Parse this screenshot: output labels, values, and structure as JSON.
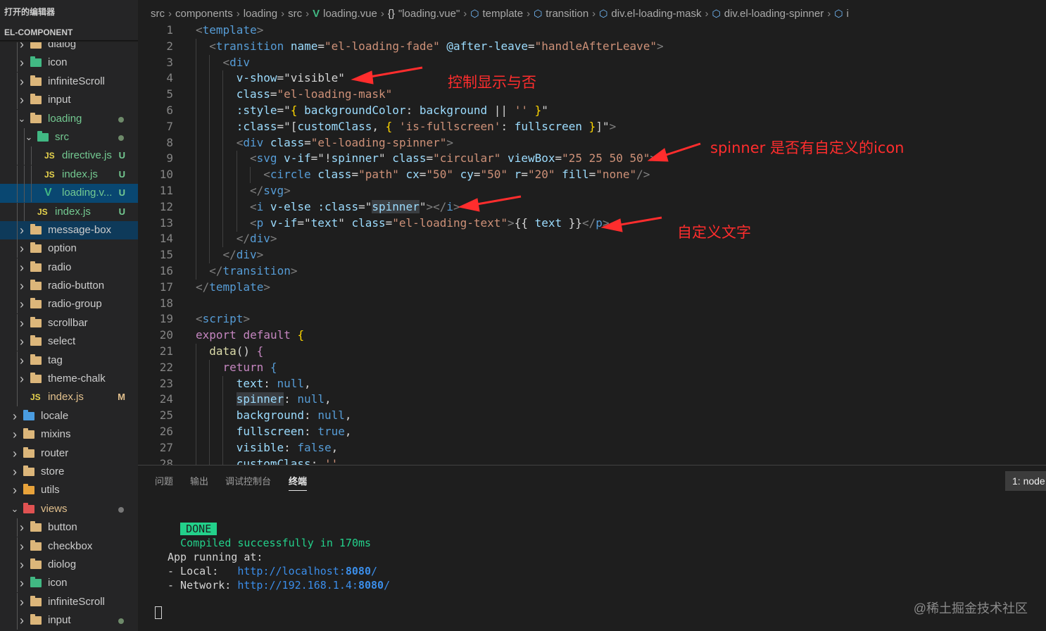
{
  "sidebar": {
    "open_editors": "打开的编辑器",
    "project": "EL-COMPONENT",
    "tree": [
      {
        "label": "dialog",
        "depth": 1,
        "kind": "folder",
        "open": false
      },
      {
        "label": "icon",
        "depth": 1,
        "kind": "folder-green",
        "open": false
      },
      {
        "label": "infiniteScroll",
        "depth": 1,
        "kind": "folder",
        "open": false
      },
      {
        "label": "input",
        "depth": 1,
        "kind": "folder",
        "open": false
      },
      {
        "label": "loading",
        "depth": 1,
        "kind": "folder",
        "open": true,
        "git": true,
        "dot": true
      },
      {
        "label": "src",
        "depth": 2,
        "kind": "folder-green",
        "open": true,
        "git": true,
        "dot": true
      },
      {
        "label": "directive.js",
        "depth": 3,
        "kind": "js",
        "git": true,
        "badge": "U"
      },
      {
        "label": "index.js",
        "depth": 3,
        "kind": "js",
        "git": true,
        "badge": "U"
      },
      {
        "label": "loading.v...",
        "depth": 3,
        "kind": "vue",
        "git": true,
        "badge": "U",
        "selected": true
      },
      {
        "label": "index.js",
        "depth": 2,
        "kind": "js",
        "git": true,
        "badge": "U"
      },
      {
        "label": "message-box",
        "depth": 1,
        "kind": "folder",
        "open": false,
        "focus": true
      },
      {
        "label": "option",
        "depth": 1,
        "kind": "folder",
        "open": false
      },
      {
        "label": "radio",
        "depth": 1,
        "kind": "folder",
        "open": false
      },
      {
        "label": "radio-button",
        "depth": 1,
        "kind": "folder",
        "open": false
      },
      {
        "label": "radio-group",
        "depth": 1,
        "kind": "folder",
        "open": false
      },
      {
        "label": "scrollbar",
        "depth": 1,
        "kind": "folder",
        "open": false
      },
      {
        "label": "select",
        "depth": 1,
        "kind": "folder",
        "open": false
      },
      {
        "label": "tag",
        "depth": 1,
        "kind": "folder",
        "open": false
      },
      {
        "label": "theme-chalk",
        "depth": 1,
        "kind": "folder",
        "open": false
      },
      {
        "label": "index.js",
        "depth": 1,
        "kind": "js",
        "gitm": true,
        "badge": "M"
      },
      {
        "label": "locale",
        "depth": 0,
        "kind": "folder-blue",
        "open": false
      },
      {
        "label": "mixins",
        "depth": 0,
        "kind": "folder",
        "open": false
      },
      {
        "label": "router",
        "depth": 0,
        "kind": "folder",
        "open": false
      },
      {
        "label": "store",
        "depth": 0,
        "kind": "folder",
        "open": false
      },
      {
        "label": "utils",
        "depth": 0,
        "kind": "folder-orange",
        "open": false
      },
      {
        "label": "views",
        "depth": 0,
        "kind": "folder-red",
        "open": true,
        "gitm": true,
        "dot": true
      },
      {
        "label": "button",
        "depth": 1,
        "kind": "folder",
        "open": false
      },
      {
        "label": "checkbox",
        "depth": 1,
        "kind": "folder",
        "open": false
      },
      {
        "label": "diolog",
        "depth": 1,
        "kind": "folder",
        "open": false
      },
      {
        "label": "icon",
        "depth": 1,
        "kind": "folder-green",
        "open": false
      },
      {
        "label": "infiniteScroll",
        "depth": 1,
        "kind": "folder",
        "open": false
      },
      {
        "label": "input",
        "depth": 1,
        "kind": "folder",
        "open": false,
        "dot": true
      }
    ]
  },
  "breadcrumb": [
    {
      "label": "src"
    },
    {
      "label": "components"
    },
    {
      "label": "loading"
    },
    {
      "label": "src"
    },
    {
      "label": "loading.vue",
      "icon": "vue-icon"
    },
    {
      "label": "\"loading.vue\"",
      "icon": "braces-icon"
    },
    {
      "label": "template",
      "icon": "cube-icon"
    },
    {
      "label": "transition",
      "icon": "cube-icon"
    },
    {
      "label": "div.el-loading-mask",
      "icon": "cube-icon"
    },
    {
      "label": "div.el-loading-spinner",
      "icon": "cube-icon"
    },
    {
      "label": "i",
      "icon": "cube-icon"
    }
  ],
  "code_lines": [
    {
      "n": "1",
      "indent": 0,
      "tokens": [
        [
          "t-tag",
          "<"
        ],
        [
          "t-name",
          "template"
        ],
        [
          "t-tag",
          ">"
        ]
      ]
    },
    {
      "n": "2",
      "indent": 1,
      "tokens": [
        [
          "t-tag",
          "<"
        ],
        [
          "t-name",
          "transition"
        ],
        [
          "t-plain",
          " "
        ],
        [
          "t-attr",
          "name"
        ],
        [
          "t-plain",
          "="
        ],
        [
          "t-str",
          "\"el-loading-fade\""
        ],
        [
          "t-plain",
          " "
        ],
        [
          "t-attr",
          "@after-leave"
        ],
        [
          "t-plain",
          "="
        ],
        [
          "t-str",
          "\"handleAfterLeave\""
        ],
        [
          "t-tag",
          ">"
        ]
      ]
    },
    {
      "n": "3",
      "indent": 2,
      "tokens": [
        [
          "t-tag",
          "<"
        ],
        [
          "t-name",
          "div"
        ]
      ]
    },
    {
      "n": "4",
      "indent": 3,
      "tokens": [
        [
          "t-attr",
          "v-show"
        ],
        [
          "t-plain",
          "="
        ],
        [
          "t-plain",
          "\"visible\""
        ]
      ]
    },
    {
      "n": "5",
      "indent": 3,
      "tokens": [
        [
          "t-attr",
          "class"
        ],
        [
          "t-plain",
          "="
        ],
        [
          "t-str",
          "\"el-loading-mask\""
        ]
      ]
    },
    {
      "n": "6",
      "indent": 3,
      "tokens": [
        [
          "t-attr",
          ":style"
        ],
        [
          "t-plain",
          "=\""
        ],
        [
          "t-brace",
          "{"
        ],
        [
          "t-plain",
          " "
        ],
        [
          "t-attr",
          "backgroundColor"
        ],
        [
          "t-plain",
          ": "
        ],
        [
          "t-attr",
          "background"
        ],
        [
          "t-plain",
          " || "
        ],
        [
          "t-str",
          "''"
        ],
        [
          "t-plain",
          " "
        ],
        [
          "t-brace",
          "}"
        ],
        [
          "t-plain",
          "\""
        ]
      ]
    },
    {
      "n": "7",
      "indent": 3,
      "tokens": [
        [
          "t-attr",
          ":class"
        ],
        [
          "t-plain",
          "=\"["
        ],
        [
          "t-attr",
          "customClass"
        ],
        [
          "t-plain",
          ", "
        ],
        [
          "t-brace",
          "{"
        ],
        [
          "t-plain",
          " "
        ],
        [
          "t-str",
          "'is-fullscreen'"
        ],
        [
          "t-plain",
          ": "
        ],
        [
          "t-attr",
          "fullscreen"
        ],
        [
          "t-plain",
          " "
        ],
        [
          "t-brace",
          "}"
        ],
        [
          "t-plain",
          "]\""
        ],
        [
          "t-tag",
          ">"
        ]
      ]
    },
    {
      "n": "8",
      "indent": 3,
      "tokens": [
        [
          "t-tag",
          "<"
        ],
        [
          "t-name",
          "div"
        ],
        [
          "t-plain",
          " "
        ],
        [
          "t-attr",
          "class"
        ],
        [
          "t-plain",
          "="
        ],
        [
          "t-str",
          "\"el-loading-spinner\""
        ],
        [
          "t-tag",
          ">"
        ]
      ]
    },
    {
      "n": "9",
      "indent": 4,
      "tokens": [
        [
          "t-tag",
          "<"
        ],
        [
          "t-name",
          "svg"
        ],
        [
          "t-plain",
          " "
        ],
        [
          "t-attr",
          "v-if"
        ],
        [
          "t-plain",
          "=\"!"
        ],
        [
          "t-attr",
          "spinner"
        ],
        [
          "t-plain",
          "\" "
        ],
        [
          "t-attr",
          "class"
        ],
        [
          "t-plain",
          "="
        ],
        [
          "t-str",
          "\"circular\""
        ],
        [
          "t-plain",
          " "
        ],
        [
          "t-attr",
          "viewBox"
        ],
        [
          "t-plain",
          "="
        ],
        [
          "t-str",
          "\"25 25 50 50\""
        ],
        [
          "t-tag",
          ">"
        ]
      ]
    },
    {
      "n": "10",
      "indent": 5,
      "tokens": [
        [
          "t-tag",
          "<"
        ],
        [
          "t-name",
          "circle"
        ],
        [
          "t-plain",
          " "
        ],
        [
          "t-attr",
          "class"
        ],
        [
          "t-plain",
          "="
        ],
        [
          "t-str",
          "\"path\""
        ],
        [
          "t-plain",
          " "
        ],
        [
          "t-attr",
          "cx"
        ],
        [
          "t-plain",
          "="
        ],
        [
          "t-str",
          "\"50\""
        ],
        [
          "t-plain",
          " "
        ],
        [
          "t-attr",
          "cy"
        ],
        [
          "t-plain",
          "="
        ],
        [
          "t-str",
          "\"50\""
        ],
        [
          "t-plain",
          " "
        ],
        [
          "t-attr",
          "r"
        ],
        [
          "t-plain",
          "="
        ],
        [
          "t-str",
          "\"20\""
        ],
        [
          "t-plain",
          " "
        ],
        [
          "t-attr",
          "fill"
        ],
        [
          "t-plain",
          "="
        ],
        [
          "t-str",
          "\"none\""
        ],
        [
          "t-tag",
          "/>"
        ]
      ]
    },
    {
      "n": "11",
      "indent": 4,
      "tokens": [
        [
          "t-tag",
          "</"
        ],
        [
          "t-name",
          "svg"
        ],
        [
          "t-tag",
          ">"
        ]
      ]
    },
    {
      "n": "12",
      "indent": 4,
      "tokens": [
        [
          "t-tag",
          "<"
        ],
        [
          "t-name",
          "i"
        ],
        [
          "t-plain",
          " "
        ],
        [
          "t-attr",
          "v-else"
        ],
        [
          "t-plain",
          " "
        ],
        [
          "t-attr",
          ":class"
        ],
        [
          "t-plain",
          "=\""
        ],
        [
          "t-hl",
          "spinner"
        ],
        [
          "t-plain",
          "\""
        ],
        [
          "t-tag",
          "></"
        ],
        [
          "t-name",
          "i"
        ],
        [
          "t-tag",
          ">"
        ]
      ]
    },
    {
      "n": "13",
      "indent": 4,
      "tokens": [
        [
          "t-tag",
          "<"
        ],
        [
          "t-name",
          "p"
        ],
        [
          "t-plain",
          " "
        ],
        [
          "t-attr",
          "v-if"
        ],
        [
          "t-plain",
          "=\""
        ],
        [
          "t-attr",
          "text"
        ],
        [
          "t-plain",
          "\" "
        ],
        [
          "t-attr",
          "class"
        ],
        [
          "t-plain",
          "="
        ],
        [
          "t-str",
          "\"el-loading-text\""
        ],
        [
          "t-tag",
          ">"
        ],
        [
          "t-plain",
          "{{ "
        ],
        [
          "t-attr",
          "text"
        ],
        [
          "t-plain",
          " }}"
        ],
        [
          "t-tag",
          "</"
        ],
        [
          "t-name",
          "p"
        ],
        [
          "t-tag",
          ">"
        ]
      ]
    },
    {
      "n": "14",
      "indent": 3,
      "tokens": [
        [
          "t-tag",
          "</"
        ],
        [
          "t-name",
          "div"
        ],
        [
          "t-tag",
          ">"
        ]
      ]
    },
    {
      "n": "15",
      "indent": 2,
      "tokens": [
        [
          "t-tag",
          "</"
        ],
        [
          "t-name",
          "div"
        ],
        [
          "t-tag",
          ">"
        ]
      ]
    },
    {
      "n": "16",
      "indent": 1,
      "tokens": [
        [
          "t-tag",
          "</"
        ],
        [
          "t-name",
          "transition"
        ],
        [
          "t-tag",
          ">"
        ]
      ]
    },
    {
      "n": "17",
      "indent": 0,
      "tokens": [
        [
          "t-tag",
          "</"
        ],
        [
          "t-name",
          "template"
        ],
        [
          "t-tag",
          ">"
        ]
      ]
    },
    {
      "n": "18",
      "indent": 0,
      "tokens": []
    },
    {
      "n": "19",
      "indent": 0,
      "tokens": [
        [
          "t-tag",
          "<"
        ],
        [
          "t-name",
          "script"
        ],
        [
          "t-tag",
          ">"
        ]
      ]
    },
    {
      "n": "20",
      "indent": 0,
      "tokens": [
        [
          "t-ctrl",
          "export"
        ],
        [
          "t-plain",
          " "
        ],
        [
          "t-ctrl",
          "default"
        ],
        [
          "t-plain",
          " "
        ],
        [
          "t-brace",
          "{"
        ]
      ]
    },
    {
      "n": "21",
      "indent": 1,
      "tokens": [
        [
          "t-fn",
          "data"
        ],
        [
          "t-plain",
          "() "
        ],
        [
          "t-ctrl",
          "{"
        ]
      ]
    },
    {
      "n": "22",
      "indent": 2,
      "tokens": [
        [
          "t-ctrl",
          "return"
        ],
        [
          "t-plain",
          " "
        ],
        [
          "t-kw",
          "{"
        ]
      ]
    },
    {
      "n": "23",
      "indent": 3,
      "tokens": [
        [
          "t-attr",
          "text"
        ],
        [
          "t-plain",
          ": "
        ],
        [
          "t-kw",
          "null"
        ],
        [
          "t-plain",
          ","
        ]
      ]
    },
    {
      "n": "24",
      "indent": 3,
      "tokens": [
        [
          "t-hl",
          "spinner"
        ],
        [
          "t-plain",
          ": "
        ],
        [
          "t-kw",
          "null"
        ],
        [
          "t-plain",
          ","
        ]
      ]
    },
    {
      "n": "25",
      "indent": 3,
      "tokens": [
        [
          "t-attr",
          "background"
        ],
        [
          "t-plain",
          ": "
        ],
        [
          "t-kw",
          "null"
        ],
        [
          "t-plain",
          ","
        ]
      ]
    },
    {
      "n": "26",
      "indent": 3,
      "tokens": [
        [
          "t-attr",
          "fullscreen"
        ],
        [
          "t-plain",
          ": "
        ],
        [
          "t-kw",
          "true"
        ],
        [
          "t-plain",
          ","
        ]
      ]
    },
    {
      "n": "27",
      "indent": 3,
      "tokens": [
        [
          "t-attr",
          "visible"
        ],
        [
          "t-plain",
          ": "
        ],
        [
          "t-kw",
          "false"
        ],
        [
          "t-plain",
          ","
        ]
      ]
    },
    {
      "n": "28",
      "indent": 3,
      "tokens": [
        [
          "t-attr",
          "customClass"
        ],
        [
          "t-plain",
          ": "
        ],
        [
          "t-str",
          "''"
        ]
      ]
    }
  ],
  "annotations": {
    "show_hide": "控制显示与否",
    "spinner_icon": "spinner 是否有自定义的icon",
    "custom_text": "自定义文字"
  },
  "panel": {
    "tabs": [
      "问题",
      "输出",
      "调试控制台",
      "终端"
    ],
    "active_tab": "终端",
    "terminal_select": "1: node",
    "terminal": {
      "done_badge": "DONE",
      "compiled": "Compiled successfully in 170ms",
      "app_running": "App running at:",
      "local_label": "- Local:   ",
      "local_url_prefix": "http://localhost:",
      "local_port": "8080",
      "local_url_suffix": "/",
      "network_label": "- Network: ",
      "network_url_prefix": "http://192.168.1.4:",
      "network_port": "8080",
      "network_url_suffix": "/"
    },
    "watermark": "@稀土掘金技术社区"
  },
  "colors": {
    "editor_bg": "#1e1e1e",
    "sidebar_bg": "#252526",
    "selection": "#094771",
    "annotation_red": "#ff2d2d",
    "done_green": "#23d18b"
  }
}
